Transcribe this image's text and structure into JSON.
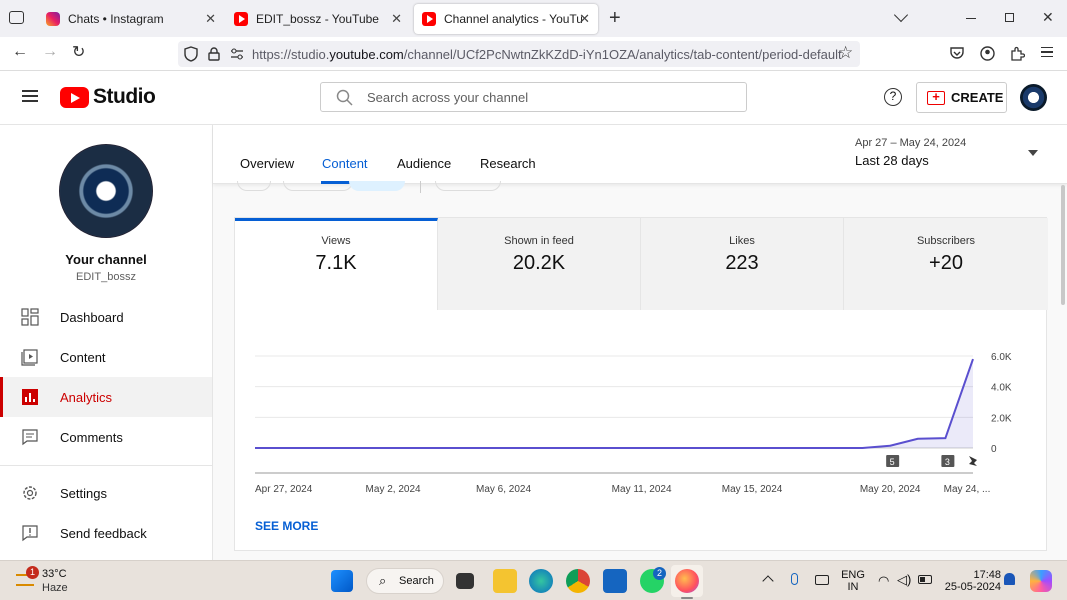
{
  "browser": {
    "tabs": [
      {
        "title": "Chats • Instagram",
        "icon": "instagram-icon",
        "active": false
      },
      {
        "title": "EDIT_bossz - YouTube",
        "icon": "youtube-icon",
        "active": false
      },
      {
        "title": "Channel analytics - YouTube Stu",
        "icon": "youtube-icon",
        "active": true
      }
    ],
    "url_prefix": "https://studio.",
    "url_host": "youtube.com",
    "url_path": "/channel/UCf2PcNwtnZkKZdD-iYn1OZA/analytics/tab-content/period-default"
  },
  "studio": {
    "logo_text": "Studio",
    "search_placeholder": "Search across your channel",
    "create_label": "CREATE",
    "help_glyph": "?"
  },
  "sidebar": {
    "channel_heading": "Your channel",
    "channel_name": "EDIT_bossz",
    "items": [
      {
        "label": "Dashboard",
        "icon": "dashboard-icon",
        "active": false
      },
      {
        "label": "Content",
        "icon": "content-icon",
        "active": false
      },
      {
        "label": "Analytics",
        "icon": "analytics-icon",
        "active": true
      },
      {
        "label": "Comments",
        "icon": "comments-icon",
        "active": false
      },
      {
        "label": "Settings",
        "icon": "settings-icon",
        "active": false
      },
      {
        "label": "Send feedback",
        "icon": "feedback-icon",
        "active": false
      }
    ]
  },
  "analytics": {
    "tabs": [
      "Overview",
      "Content",
      "Audience",
      "Research"
    ],
    "active_tab": "Content",
    "date_range": "Apr 27 – May 24, 2024",
    "period_label": "Last 28 days",
    "metrics": [
      {
        "title": "Views",
        "value": "7.1K",
        "active": true
      },
      {
        "title": "Shown in feed",
        "value": "20.2K",
        "active": false
      },
      {
        "title": "Likes",
        "value": "223",
        "active": false
      },
      {
        "title": "Subscribers",
        "value": "+20",
        "active": false
      }
    ],
    "see_more_label": "SEE MORE"
  },
  "chart_data": {
    "type": "area",
    "title": "",
    "xlabel": "",
    "ylabel": "",
    "x_tick_labels": [
      "Apr 27, 2024",
      "May 2, 2024",
      "May 6, 2024",
      "May 11, 2024",
      "May 15, 2024",
      "May 20, 2024",
      "May 24, ..."
    ],
    "y_tick_labels": [
      "6.0K",
      "4.0K",
      "2.0K",
      "0"
    ],
    "ylim": [
      0,
      6000
    ],
    "series": [
      {
        "values": [
          0,
          0,
          0,
          0,
          0,
          0,
          0,
          0,
          0,
          0,
          0,
          0,
          0,
          0,
          0,
          0,
          0,
          0,
          0,
          0,
          0,
          0,
          0,
          150,
          600,
          640,
          5800
        ]
      }
    ],
    "markers": [
      {
        "label": "5",
        "day_index": 23
      },
      {
        "label": "3",
        "day_index": 25
      }
    ],
    "color": "#5a4fcf",
    "grid": true
  },
  "taskbar": {
    "weather_temp": "33°C",
    "weather_desc": "Haze",
    "weather_badge": "1",
    "search_label": "Search",
    "whatsapp_badge": "2",
    "lang_line1": "ENG",
    "lang_line2": "IN",
    "time": "17:48",
    "date": "25-05-2024"
  }
}
